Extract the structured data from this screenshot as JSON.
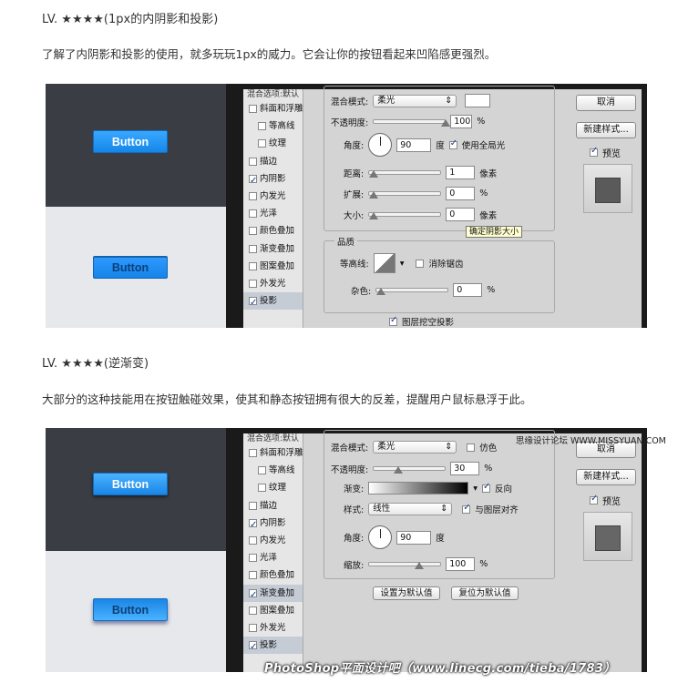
{
  "section1": {
    "heading": "LV. ★★★★(1px的内阴影和投影)",
    "paragraph": "了解了内阴影和投影的使用，就多玩玩1px的威力。它会让你的按钮看起来凹陷感更强烈。",
    "preview": {
      "dark_button": "Button",
      "light_button": "Button"
    },
    "styles_list": {
      "header": "混合选项:默认",
      "items": [
        {
          "label": "斜面和浮雕",
          "checked": false
        },
        {
          "label": "等高线",
          "checked": false
        },
        {
          "label": "纹理",
          "checked": false
        },
        {
          "label": "描边",
          "checked": false
        },
        {
          "label": "内阴影",
          "checked": true
        },
        {
          "label": "内发光",
          "checked": false
        },
        {
          "label": "光泽",
          "checked": false
        },
        {
          "label": "颜色叠加",
          "checked": false
        },
        {
          "label": "渐变叠加",
          "checked": false
        },
        {
          "label": "图案叠加",
          "checked": false
        },
        {
          "label": "外发光",
          "checked": false
        },
        {
          "label": "投影",
          "checked": true
        }
      ]
    },
    "structure": {
      "blend_label": "混合模式:",
      "blend_value": "柔光",
      "opacity_label": "不透明度:",
      "opacity_value": "100",
      "percent": "%",
      "angle_label": "角度:",
      "angle_value": "90",
      "degree": "度",
      "global_light_label": "使用全局光",
      "distance_label": "距离:",
      "distance_value": "1",
      "spread_label": "扩展:",
      "spread_value": "0",
      "size_label": "大小:",
      "size_value": "0",
      "pixels": "像素",
      "tooltip": "确定阴影大小"
    },
    "quality": {
      "title": "品质",
      "contour_label": "等高线:",
      "antialias_label": "消除锯齿",
      "noise_label": "杂色:",
      "noise_value": "0",
      "percent": "%",
      "knockout_label": "图层挖空投影"
    },
    "right": {
      "cancel": "取消",
      "new_style": "新建样式...",
      "preview": "预览"
    }
  },
  "section2": {
    "heading": "LV. ★★★★(逆渐变)",
    "paragraph": "大部分的这种技能用在按钮触碰效果，使其和静态按钮拥有很大的反差，提醒用户鼠标悬浮于此。",
    "preview": {
      "dark_button": "Button",
      "light_button": "Button"
    },
    "styles_list": {
      "header": "混合选项:默认",
      "items": [
        {
          "label": "斜面和浮雕",
          "checked": false
        },
        {
          "label": "等高线",
          "checked": false
        },
        {
          "label": "纹理",
          "checked": false
        },
        {
          "label": "描边",
          "checked": false
        },
        {
          "label": "内阴影",
          "checked": true
        },
        {
          "label": "内发光",
          "checked": false
        },
        {
          "label": "光泽",
          "checked": false
        },
        {
          "label": "颜色叠加",
          "checked": false
        },
        {
          "label": "渐变叠加",
          "checked": true
        },
        {
          "label": "图案叠加",
          "checked": false
        },
        {
          "label": "外发光",
          "checked": false
        },
        {
          "label": "投影",
          "checked": true
        }
      ]
    },
    "gradient": {
      "blend_label": "混合模式:",
      "blend_value": "柔光",
      "dither_label": "仿色",
      "opacity_label": "不透明度:",
      "opacity_value": "30",
      "percent": "%",
      "gradient_label": "渐变:",
      "reverse_label": "反向",
      "style_label": "样式:",
      "style_value": "线性",
      "align_label": "与图层对齐",
      "angle_label": "角度:",
      "angle_value": "90",
      "degree": "度",
      "scale_label": "缩放:",
      "scale_value": "100",
      "default_btn": "设置为默认值",
      "reset_btn": "复位为默认值"
    },
    "right": {
      "cancel": "取消",
      "new_style": "新建样式...",
      "preview": "预览"
    },
    "watermark_site": "思缘设计论坛 WWW.MISSYUAN.COM",
    "watermark_banner": "PhotoShop平面设计吧（www.linecg.com/tieba/1783）"
  }
}
